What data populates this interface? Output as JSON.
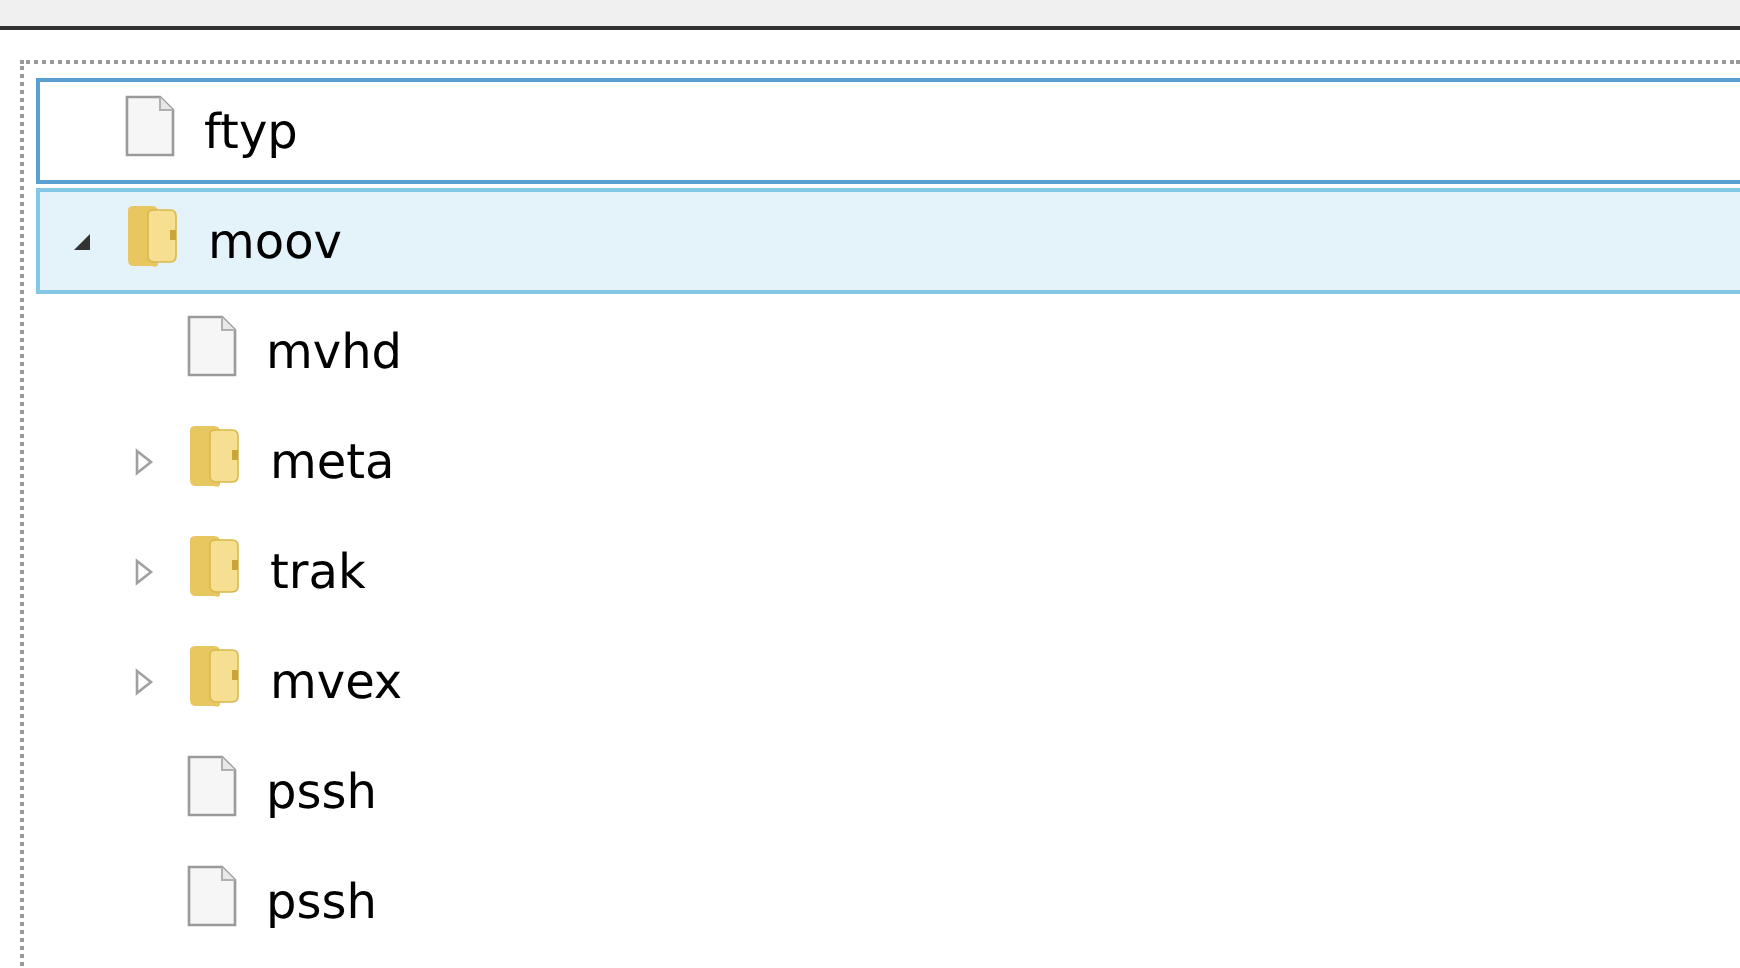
{
  "tree": {
    "items": [
      {
        "kind": "file",
        "name": "ftyp",
        "selected": false,
        "focused": true
      },
      {
        "kind": "folder",
        "name": "moov",
        "selected": true,
        "focused": false,
        "expanded": true,
        "children": [
          {
            "kind": "file",
            "name": "mvhd",
            "selected": false,
            "focused": false
          },
          {
            "kind": "folder",
            "name": "meta",
            "selected": false,
            "focused": false,
            "expanded": false
          },
          {
            "kind": "folder",
            "name": "trak",
            "selected": false,
            "focused": false,
            "expanded": false
          },
          {
            "kind": "folder",
            "name": "mvex",
            "selected": false,
            "focused": false,
            "expanded": false
          },
          {
            "kind": "file",
            "name": "pssh",
            "selected": false,
            "focused": false
          },
          {
            "kind": "file",
            "name": "pssh",
            "selected": false,
            "focused": false
          }
        ]
      }
    ]
  }
}
